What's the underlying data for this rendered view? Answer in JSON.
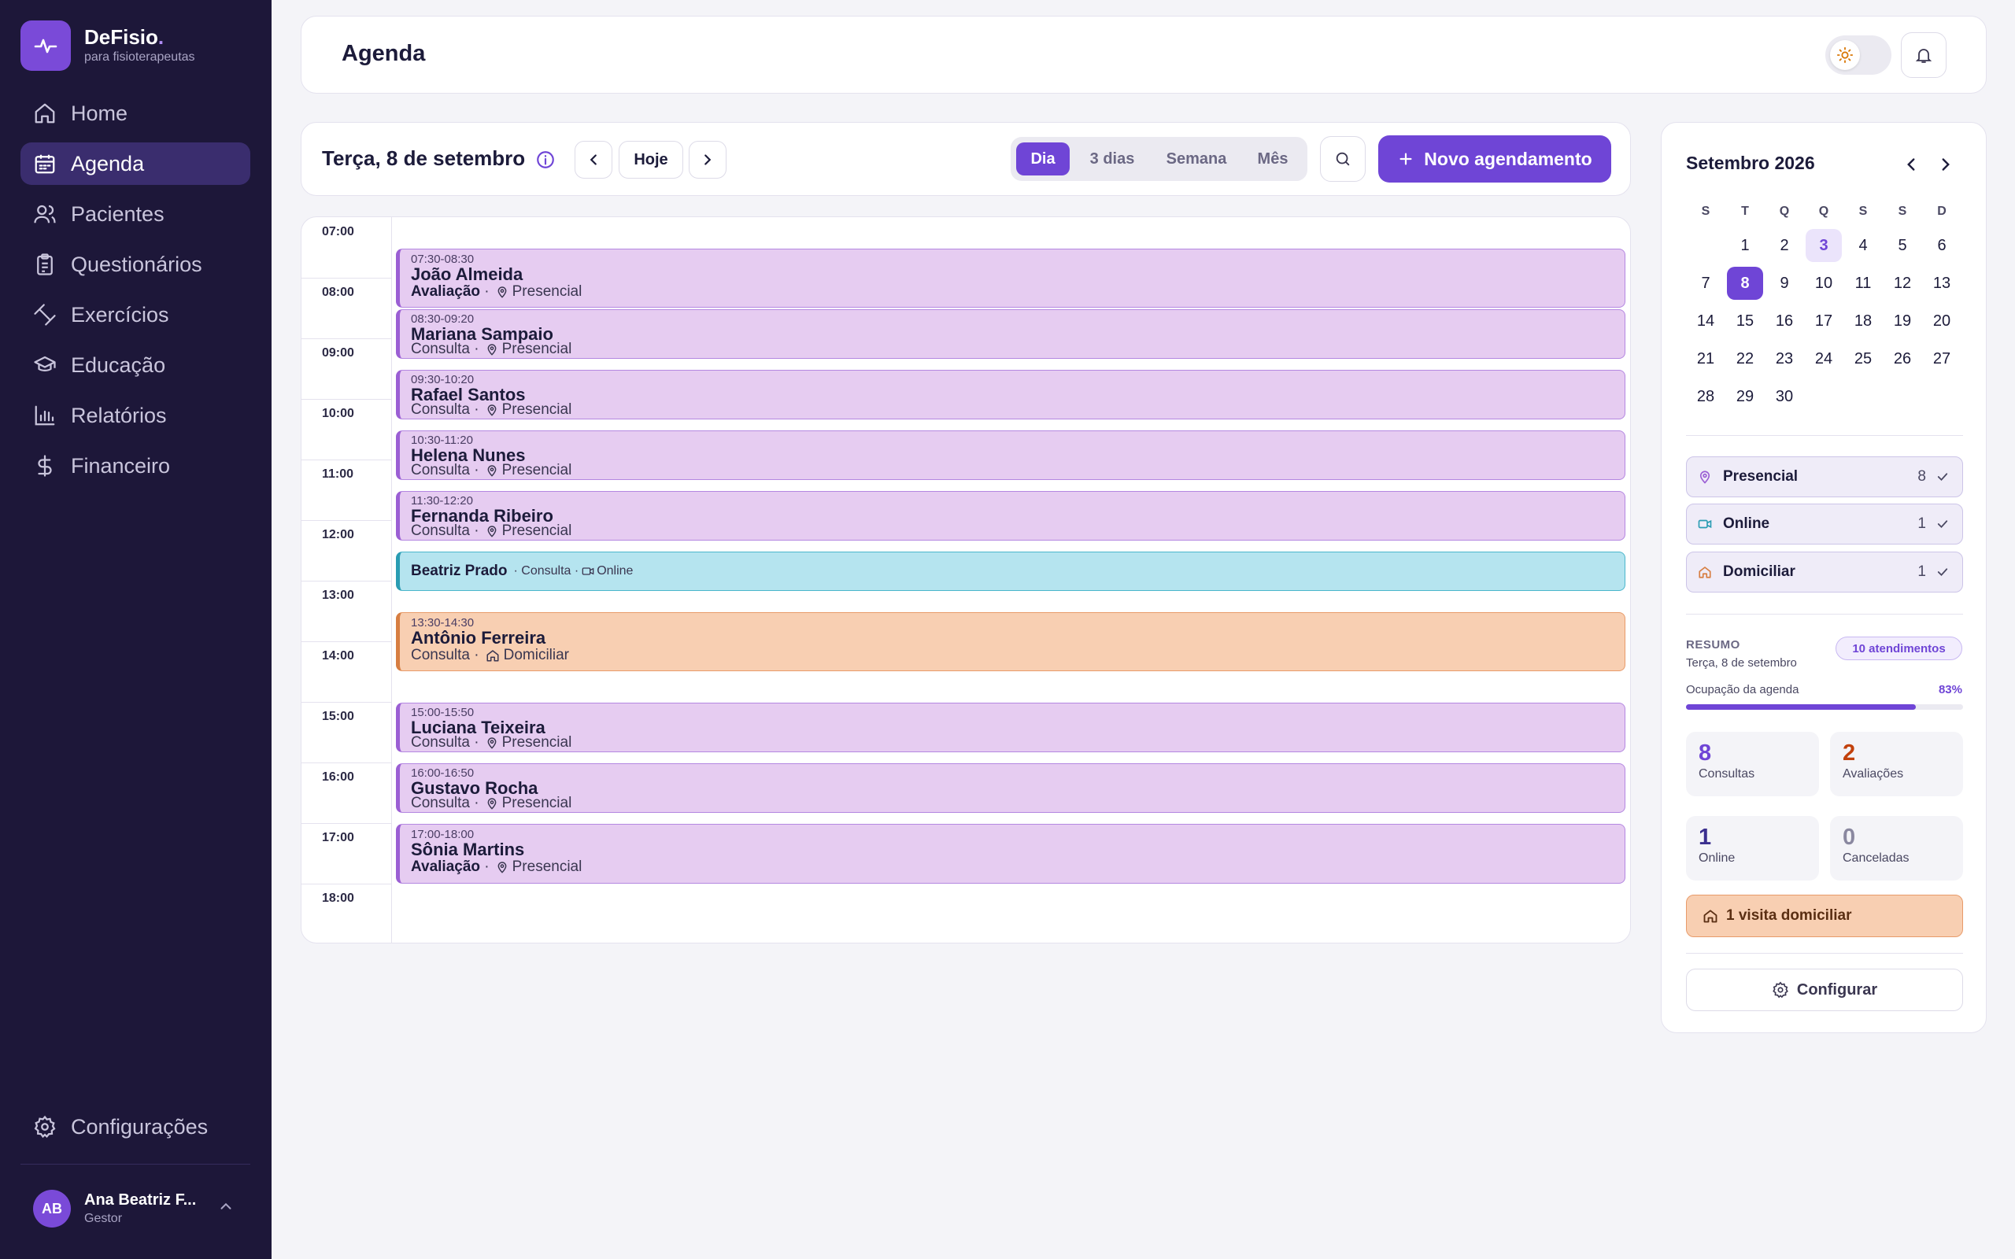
{
  "brand": {
    "name": "DeFisio",
    "dot": ".",
    "tagline": "para fisioterapeutas"
  },
  "sidebar": {
    "items": [
      {
        "label": "Home",
        "icon": "home-icon"
      },
      {
        "label": "Agenda",
        "icon": "calendar-icon",
        "active": true
      },
      {
        "label": "Pacientes",
        "icon": "users-icon"
      },
      {
        "label": "Questionários",
        "icon": "clipboard-icon"
      },
      {
        "label": "Exercícios",
        "icon": "dumbbell-icon"
      },
      {
        "label": "Educação",
        "icon": "graduation-cap-icon"
      },
      {
        "label": "Relatórios",
        "icon": "bar-chart-icon"
      },
      {
        "label": "Financeiro",
        "icon": "dollar-icon"
      }
    ],
    "settings_label": "Configurações"
  },
  "user": {
    "initials": "AB",
    "name": "Ana Beatriz F...",
    "role": "Gestor"
  },
  "header": {
    "title": "Agenda"
  },
  "toolbar": {
    "date": "Terça, 8 de setembro",
    "today_label": "Hoje",
    "views": [
      "Dia",
      "3 dias",
      "Semana",
      "Mês"
    ],
    "active_view": "Dia",
    "new_button": "Novo agendamento"
  },
  "calendar": {
    "hours": [
      "07:00",
      "08:00",
      "09:00",
      "10:00",
      "11:00",
      "12:00",
      "13:00",
      "14:00",
      "15:00",
      "16:00",
      "17:00",
      "18:00"
    ],
    "events": [
      {
        "time": "07:30-08:30",
        "name": "João Almeida",
        "kind": "Avaliação",
        "mode": "Presencial",
        "type": "presencial"
      },
      {
        "time": "08:30-09:20",
        "name": "Mariana Sampaio",
        "kind": "Consulta",
        "mode": "Presencial",
        "type": "presencial"
      },
      {
        "time": "09:30-10:20",
        "name": "Rafael Santos",
        "kind": "Consulta",
        "mode": "Presencial",
        "type": "presencial"
      },
      {
        "time": "10:30-11:20",
        "name": "Helena Nunes",
        "kind": "Consulta",
        "mode": "Presencial",
        "type": "presencial"
      },
      {
        "time": "11:30-12:20",
        "name": "Fernanda Ribeiro",
        "kind": "Consulta",
        "mode": "Presencial",
        "type": "presencial"
      },
      {
        "time": "",
        "name": "Beatriz Prado",
        "kind": "Consulta",
        "mode": "Online",
        "type": "online"
      },
      {
        "time": "13:30-14:30",
        "name": "Antônio Ferreira",
        "kind": "Consulta",
        "mode": "Domiciliar",
        "type": "domiciliar"
      },
      {
        "time": "15:00-15:50",
        "name": "Luciana Teixeira",
        "kind": "Consulta",
        "mode": "Presencial",
        "type": "presencial"
      },
      {
        "time": "16:00-16:50",
        "name": "Gustavo Rocha",
        "kind": "Consulta",
        "mode": "Presencial",
        "type": "presencial"
      },
      {
        "time": "17:00-18:00",
        "name": "Sônia Martins",
        "kind": "Avaliação",
        "mode": "Presencial",
        "type": "presencial"
      }
    ]
  },
  "mini_calendar": {
    "title": "Setembro 2026",
    "weekdays": [
      "S",
      "T",
      "Q",
      "Q",
      "S",
      "S",
      "D"
    ],
    "today": 3,
    "selected": 8
  },
  "filters": [
    {
      "label": "Presencial",
      "count": "8",
      "icon": "map-pin-icon",
      "color": "#9b5fd4"
    },
    {
      "label": "Online",
      "count": "1",
      "icon": "video-icon",
      "color": "#2a9cb3"
    },
    {
      "label": "Domiciliar",
      "count": "1",
      "icon": "house-icon",
      "color": "#d77e42"
    }
  ],
  "summary": {
    "label": "RESUMO",
    "date": "Terça, 8 de setembro",
    "badge": "10 atendimentos",
    "occupancy_label": "Ocupação da agenda",
    "occupancy_value": "83%",
    "occupancy_fraction": 0.83,
    "stats": [
      {
        "num": "8",
        "label": "Consultas",
        "color": "#6f45d6"
      },
      {
        "num": "2",
        "label": "Avaliações",
        "color": "#c2410c"
      },
      {
        "num": "1",
        "label": "Online",
        "color": "#3b2f8f"
      },
      {
        "num": "0",
        "label": "Canceladas",
        "color": "#8a88a0"
      }
    ],
    "home_visit": "1 visita domiciliar",
    "config_label": "Configurar"
  }
}
